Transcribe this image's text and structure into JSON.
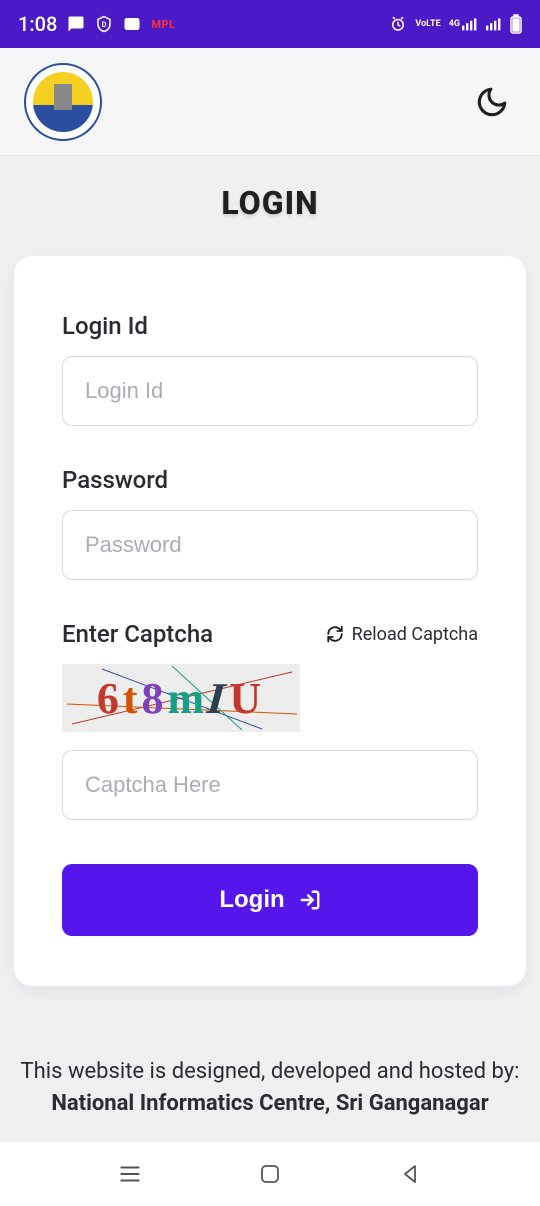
{
  "status_bar": {
    "time": "1:08",
    "mpl_badge": "MPL",
    "network_label": "4G",
    "volte_label": "VoLTE"
  },
  "header": {
    "theme_toggle_name": "dark-mode"
  },
  "page": {
    "title": "LOGIN"
  },
  "form": {
    "login_id": {
      "label": "Login Id",
      "placeholder": "Login Id"
    },
    "password": {
      "label": "Password",
      "placeholder": "Password"
    },
    "captcha": {
      "label": "Enter Captcha",
      "reload_label": "Reload Captcha",
      "input_placeholder": "Captcha Here",
      "image_text": "6t8mIU"
    },
    "submit_label": "Login"
  },
  "footer": {
    "text_prefix": "This website is designed, developed and hosted by: ",
    "org": "National Informatics Centre, Sri Ganganagar"
  }
}
